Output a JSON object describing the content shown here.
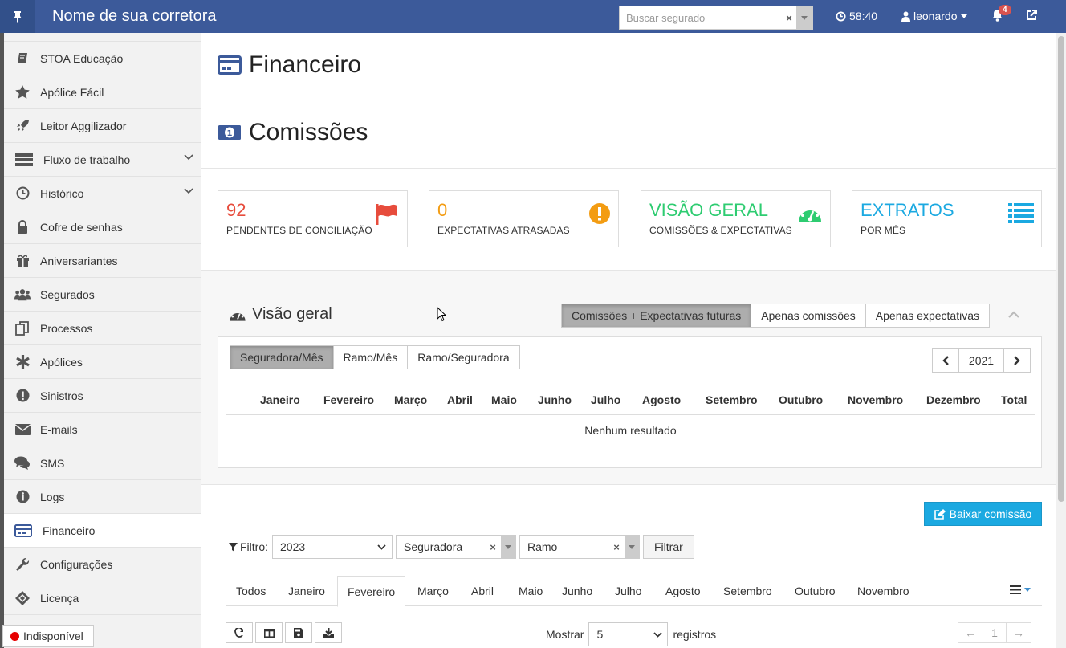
{
  "topbar": {
    "brand": "Nome de sua corretora",
    "search_placeholder": "Buscar segurado",
    "timer": "58:40",
    "user": "leonardo",
    "notifications": "4",
    "colors": {
      "bar": "#3c5a9a",
      "badge": "#d9534f"
    }
  },
  "sidebar": {
    "items": [
      {
        "label": "STOA Educação",
        "icon": "book-icon"
      },
      {
        "label": "Apólice Fácil",
        "icon": "star-icon"
      },
      {
        "label": "Leitor Aggilizador",
        "icon": "rocket-icon"
      },
      {
        "label": "Fluxo de trabalho",
        "icon": "server-icon"
      },
      {
        "label": "Histórico",
        "icon": "history-icon"
      },
      {
        "label": "Cofre de senhas",
        "icon": "lock-icon"
      },
      {
        "label": "Aniversariantes",
        "icon": "gift-icon"
      },
      {
        "label": "Segurados",
        "icon": "users-icon"
      },
      {
        "label": "Processos",
        "icon": "copy-icon"
      },
      {
        "label": "Apólices",
        "icon": "asterisk-icon"
      },
      {
        "label": "Sinistros",
        "icon": "exclamation-icon"
      },
      {
        "label": "E-mails",
        "icon": "envelope-icon"
      },
      {
        "label": "SMS",
        "icon": "comments-icon"
      },
      {
        "label": "Logs",
        "icon": "info-icon"
      },
      {
        "label": "Financeiro",
        "icon": "credit-card-icon"
      },
      {
        "label": "Configurações",
        "icon": "wrench-icon"
      },
      {
        "label": "Licença",
        "icon": "certificate-icon"
      }
    ],
    "status": "Indisponível"
  },
  "main": {
    "title": "Financeiro",
    "subtitle": "Comissões",
    "cards": [
      {
        "value": "92",
        "label": "PENDENTES DE CONCILIAÇÃO",
        "color": "#e74c3c",
        "icon": "flag-icon"
      },
      {
        "value": "0",
        "label": "EXPECTATIVAS ATRASADAS",
        "color": "#f39c12",
        "icon": "exclamation-circle-icon"
      },
      {
        "value": "VISÃO GERAL",
        "label": "COMISSÕES & EXPECTATIVAS",
        "color": "#2ecc71",
        "icon": "dashboard-icon"
      },
      {
        "value": "EXTRATOS",
        "label": "POR MÊS",
        "color": "#1ba9e1",
        "icon": "list-icon"
      }
    ],
    "overview": {
      "title": "Visão geral",
      "modes": [
        "Comissões + Expectativas futuras",
        "Apenas comissões",
        "Apenas expectativas"
      ],
      "groupings": [
        "Seguradora/Mês",
        "Ramo/Mês",
        "Ramo/Seguradora"
      ],
      "year": "2021",
      "columns": [
        "Janeiro",
        "Fevereiro",
        "Março",
        "Abril",
        "Maio",
        "Junho",
        "Julho",
        "Agosto",
        "Setembro",
        "Outubro",
        "Novembro",
        "Dezembro",
        "Total"
      ],
      "empty": "Nenhum resultado"
    },
    "baixar": "Baixar comissão",
    "filter": {
      "label": "Filtro:",
      "year": "2023",
      "seguradora": "Seguradora",
      "ramo": "Ramo",
      "button": "Filtrar"
    },
    "tabs": [
      "Todos",
      "Janeiro",
      "Fevereiro",
      "Março",
      "Abril",
      "Maio",
      "Junho",
      "Julho",
      "Agosto",
      "Setembro",
      "Outubro",
      "Novembro"
    ],
    "show": {
      "prefix": "Mostrar",
      "value": "5",
      "suffix": "registros"
    },
    "pager": {
      "prev": "←",
      "page": "1",
      "next": "→"
    }
  }
}
